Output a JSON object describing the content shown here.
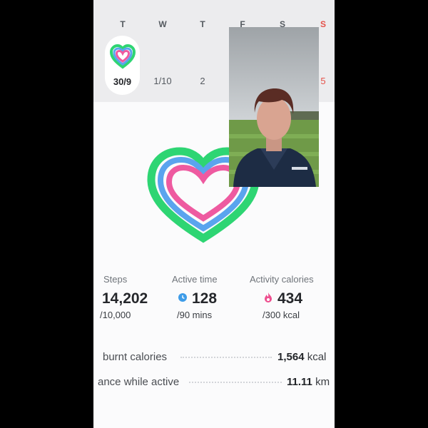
{
  "week": {
    "day_letters": [
      "T",
      "W",
      "T",
      "F",
      "S",
      "S"
    ],
    "day_numbers": [
      "30/9",
      "1/10",
      "2",
      "5"
    ],
    "sunday_color": "#e5524a"
  },
  "stats": {
    "steps": {
      "label": "Steps",
      "value": "14,202",
      "goal": "/10,000"
    },
    "active_time": {
      "label": "Active time",
      "value": "128",
      "goal": "/90 mins",
      "icon": "clock-icon"
    },
    "activity_calories": {
      "label": "Activity calories",
      "value": "434",
      "goal": "/300 kcal",
      "icon": "flame-icon"
    }
  },
  "details": {
    "burnt_calories": {
      "label": "burnt calories",
      "value": "1,564",
      "unit": "kcal"
    },
    "distance_active": {
      "label": "ance while active",
      "value": "11.11",
      "unit": "km"
    }
  },
  "colors": {
    "ring_outer": "#2ed573",
    "ring_middle": "#5aa4ee",
    "ring_inner": "#ee5aa0"
  }
}
